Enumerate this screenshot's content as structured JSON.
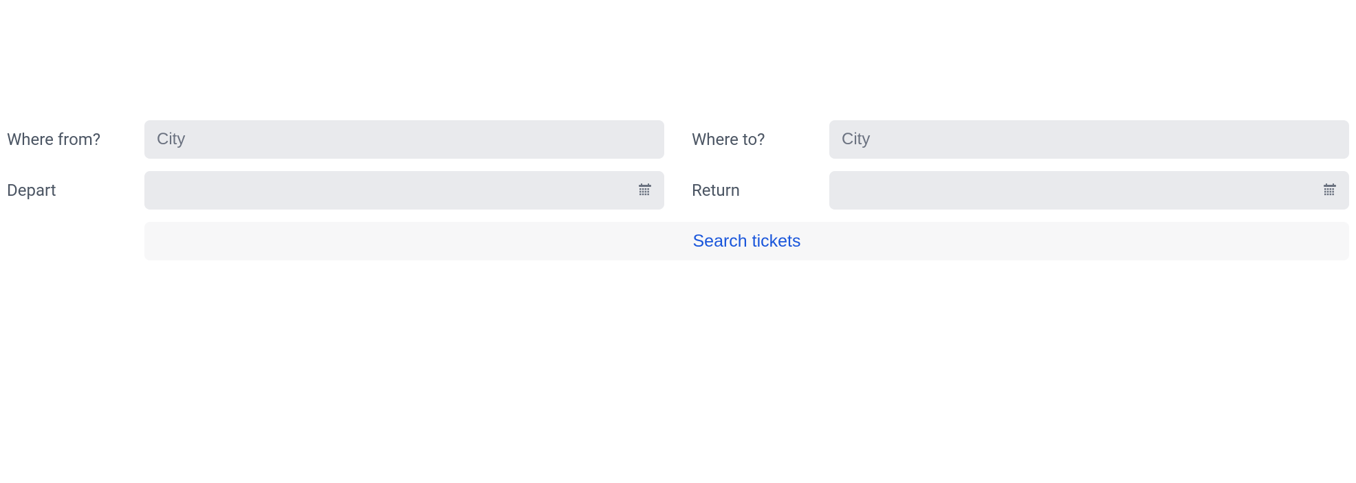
{
  "form": {
    "from": {
      "label": "Where from?",
      "placeholder": "City",
      "value": ""
    },
    "to": {
      "label": "Where to?",
      "placeholder": "City",
      "value": ""
    },
    "depart": {
      "label": "Depart",
      "placeholder": "",
      "value": ""
    },
    "return": {
      "label": "Return",
      "placeholder": "",
      "value": ""
    },
    "searchButton": "Search tickets"
  }
}
